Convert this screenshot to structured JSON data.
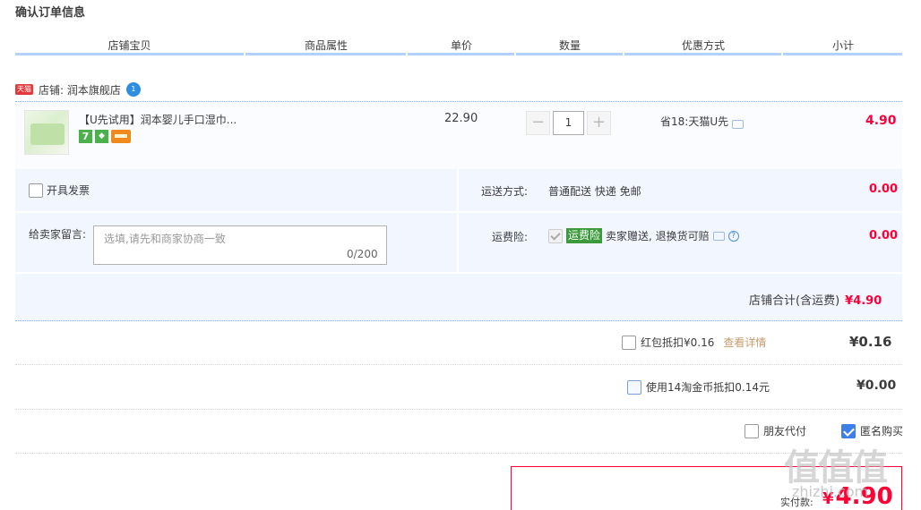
{
  "page": {
    "title": "确认订单信息"
  },
  "columns": [
    "店铺宝贝",
    "商品属性",
    "单价",
    "数量",
    "优惠方式",
    "小计"
  ],
  "shop": {
    "tmall_badge": "天猫",
    "label": "店铺: 润本旗舰店",
    "chat_badge": "1"
  },
  "item": {
    "name": "【U先试用】润本婴儿手口湿巾...",
    "badge_7": "7",
    "price": "22.90",
    "quantity": "1",
    "minus": "−",
    "plus": "+",
    "discount": "省18:天猫U先",
    "subtotal": "4.90"
  },
  "invoice": {
    "label": "开具发票"
  },
  "shipping": {
    "label": "运送方式:",
    "value": "普通配送 快递 免邮",
    "fee": "0.00"
  },
  "message": {
    "label": "给卖家留言:",
    "placeholder": "选填,请先和商家协商一致",
    "count": "0/200"
  },
  "insurance": {
    "label": "运费险:",
    "tag": "运费险",
    "text": "卖家赠送, 退换货可赔",
    "help": "?",
    "fee": "0.00"
  },
  "shop_total": {
    "label": "店铺合计(含运费)",
    "value": "¥4.90"
  },
  "red_packet": {
    "label": "红包抵扣¥0.16",
    "link": "查看详情",
    "amount": "¥0.16"
  },
  "coins": {
    "label": "使用14淘金币抵扣0.14元",
    "amount": "¥0.00"
  },
  "friend_pay": {
    "label": "朋友代付"
  },
  "anonymous": {
    "label": "匿名购买",
    "checked": true
  },
  "payment": {
    "label": "实付款:",
    "currency": "¥",
    "amount": "4.90"
  },
  "watermark": {
    "text": "值值值",
    "sub": "zhizhi.com"
  }
}
